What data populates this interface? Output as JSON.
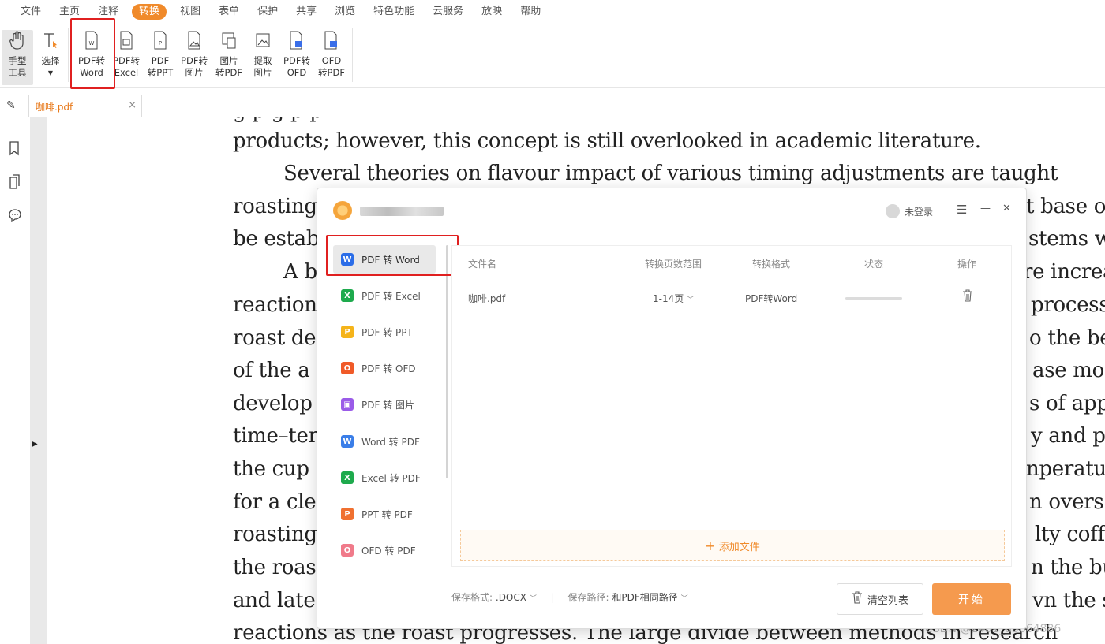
{
  "menu": [
    "文件",
    "主页",
    "注释",
    "转换",
    "视图",
    "表单",
    "保护",
    "共享",
    "浏览",
    "特色功能",
    "云服务",
    "放映",
    "帮助"
  ],
  "ribbon": {
    "hand": [
      "手型",
      "工具"
    ],
    "select": "选择",
    "tools": [
      [
        "PDF转",
        "Word"
      ],
      [
        "PDF转",
        "Excel"
      ],
      [
        "PDF",
        "转PPT"
      ],
      [
        "PDF转",
        "图片"
      ],
      [
        "图片",
        "转PDF"
      ],
      [
        "提取",
        "图片"
      ],
      [
        "PDF转",
        "OFD"
      ],
      [
        "OFD",
        "转PDF"
      ]
    ]
  },
  "tab": {
    "title": "咖啡.pdf",
    "close": "×"
  },
  "document_lines": [
    "products; however, this concept is still overlooked in academic literature.",
    "Several theories on flavour impact of various timing adjustments are taught",
    "roasting",
    "t base o",
    "be estab",
    "stems w",
    "A b",
    "re increa",
    "reaction",
    "process.",
    "roast deg",
    "o the be",
    "of the a",
    "ase mo",
    "develop",
    "s of app",
    "time–ter",
    "y and p",
    "the cup",
    "nperatur",
    "for a cle",
    "n overs",
    "roasting",
    "lty coffe",
    "the roas",
    "n the bu",
    "and late",
    "vn the s",
    "reactions as the roast progresses.  The large divide between methods in research"
  ],
  "watermark": "CSDN @2401_85664886",
  "dialog": {
    "login": "未登录",
    "window_buttons": [
      "☰",
      "—",
      "✕"
    ],
    "sidebar": [
      {
        "label": "PDF 转 Word",
        "badge": "W",
        "color": "#2b6de8"
      },
      {
        "label": "PDF 转 Excel",
        "badge": "X",
        "color": "#1eaa4d"
      },
      {
        "label": "PDF 转 PPT",
        "badge": "P",
        "color": "#f5b41a"
      },
      {
        "label": "PDF 转 OFD",
        "badge": "O",
        "color": "#f05a28"
      },
      {
        "label": "PDF 转 图片",
        "badge": "▣",
        "color": "#9a5be8"
      },
      {
        "label": "Word 转 PDF",
        "badge": "W",
        "color": "#3a7ee8"
      },
      {
        "label": "Excel 转 PDF",
        "badge": "X",
        "color": "#1eaa4d"
      },
      {
        "label": "PPT 转 PDF",
        "badge": "P",
        "color": "#f07030"
      },
      {
        "label": "OFD 转 PDF",
        "badge": "O",
        "color": "#f07a8a"
      }
    ],
    "table_headers": [
      "文件名",
      "转换页数范围",
      "转换格式",
      "状态",
      "操作"
    ],
    "row": {
      "file": "咖啡.pdf",
      "pages": "1-14页",
      "format": "PDF转Word"
    },
    "add_file": "添加文件",
    "save_format_label": "保存格式:",
    "save_format_value": ".DOCX",
    "save_path_label": "保存路径:",
    "save_path_value": "和PDF相同路径",
    "clear_button": "清空列表",
    "start_button": "开始"
  }
}
